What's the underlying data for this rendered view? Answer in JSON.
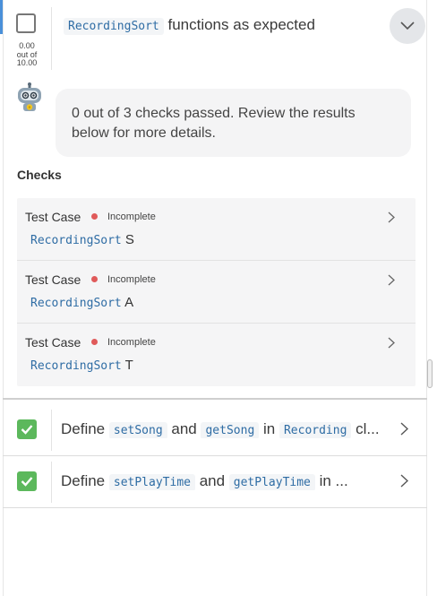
{
  "top_item": {
    "title_code": "RecordingSort",
    "title_text": " functions as expected",
    "score_value": "0.00",
    "score_of": "out of",
    "score_max": "10.00"
  },
  "summary": {
    "message": "0 out of 3 checks passed. Review the results below for more details."
  },
  "checks": {
    "heading": "Checks",
    "items": [
      {
        "type": "Test Case",
        "status": "Incomplete",
        "code": "RecordingSort",
        "suffix": " S"
      },
      {
        "type": "Test Case",
        "status": "Incomplete",
        "code": "RecordingSort",
        "suffix": " A"
      },
      {
        "type": "Test Case",
        "status": "Incomplete",
        "code": "RecordingSort",
        "suffix": " T"
      }
    ]
  },
  "rubrics": [
    {
      "t1": "Define ",
      "c1": "setSong",
      "t2": " and ",
      "c2": "getSong",
      "t3": " in ",
      "c3": "Recording",
      "t4": " cl..."
    },
    {
      "t1": "Define ",
      "c1": "setPlayTime",
      "t2": " and ",
      "c2": "getPlayTime",
      "t3": " in ..."
    }
  ],
  "colors": {
    "accent": "#4a90d9",
    "incomplete": "#e05a5a",
    "passed": "#5cb85c",
    "code": "#2e6ca4"
  },
  "icons": {
    "expand": "chevron-down-icon",
    "row": "chevron-right-icon",
    "bot": "robot-icon",
    "check": "checkmark-icon"
  }
}
